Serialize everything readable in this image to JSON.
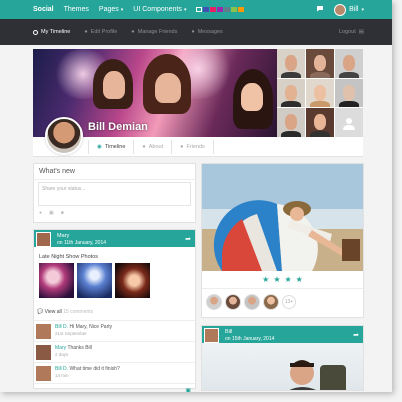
{
  "topnav": {
    "brand": "Social",
    "links": [
      "Themes",
      "Pages",
      "UI Components"
    ],
    "dropdown_marks": [
      "▾",
      "▾"
    ],
    "swatches": [
      "#26a69a",
      "#3f51b5",
      "#e91e63",
      "#9c27b0",
      "#607d8b",
      "#8bc34a",
      "#ff9800"
    ],
    "user": "Bill",
    "chat_icon": "chat-icon",
    "accent": "#26a69a"
  },
  "subnav": {
    "items": [
      "My Timeline",
      "Edit Profile",
      "Manage Friends",
      "Messages"
    ],
    "logout": "Logout"
  },
  "profile": {
    "name": "Bill Demian",
    "tabs": [
      "Timeline",
      "About",
      "Friends"
    ]
  },
  "whats_new": {
    "title": "What's new",
    "placeholder": "Share your status..."
  },
  "post1": {
    "author": "Mary",
    "date": "on 11th January, 2014",
    "title": "Late Night Show Photos",
    "view_all": "View all",
    "comment_count": "15 comments",
    "comments": [
      {
        "who": "Bill D.",
        "text": "Hi Mary, Nice Party",
        "when": "21st September"
      },
      {
        "who": "Mary",
        "text": "Thanks Bill",
        "when": "2 days"
      },
      {
        "who": "Bill D.",
        "text": "What time did it finish?",
        "when": "14 min"
      }
    ]
  },
  "beach": {
    "stars": [
      "★",
      "★",
      "★",
      "★"
    ],
    "more_friends": "13+"
  },
  "post2": {
    "author": "Bill",
    "date": "on 15th January, 2014"
  }
}
